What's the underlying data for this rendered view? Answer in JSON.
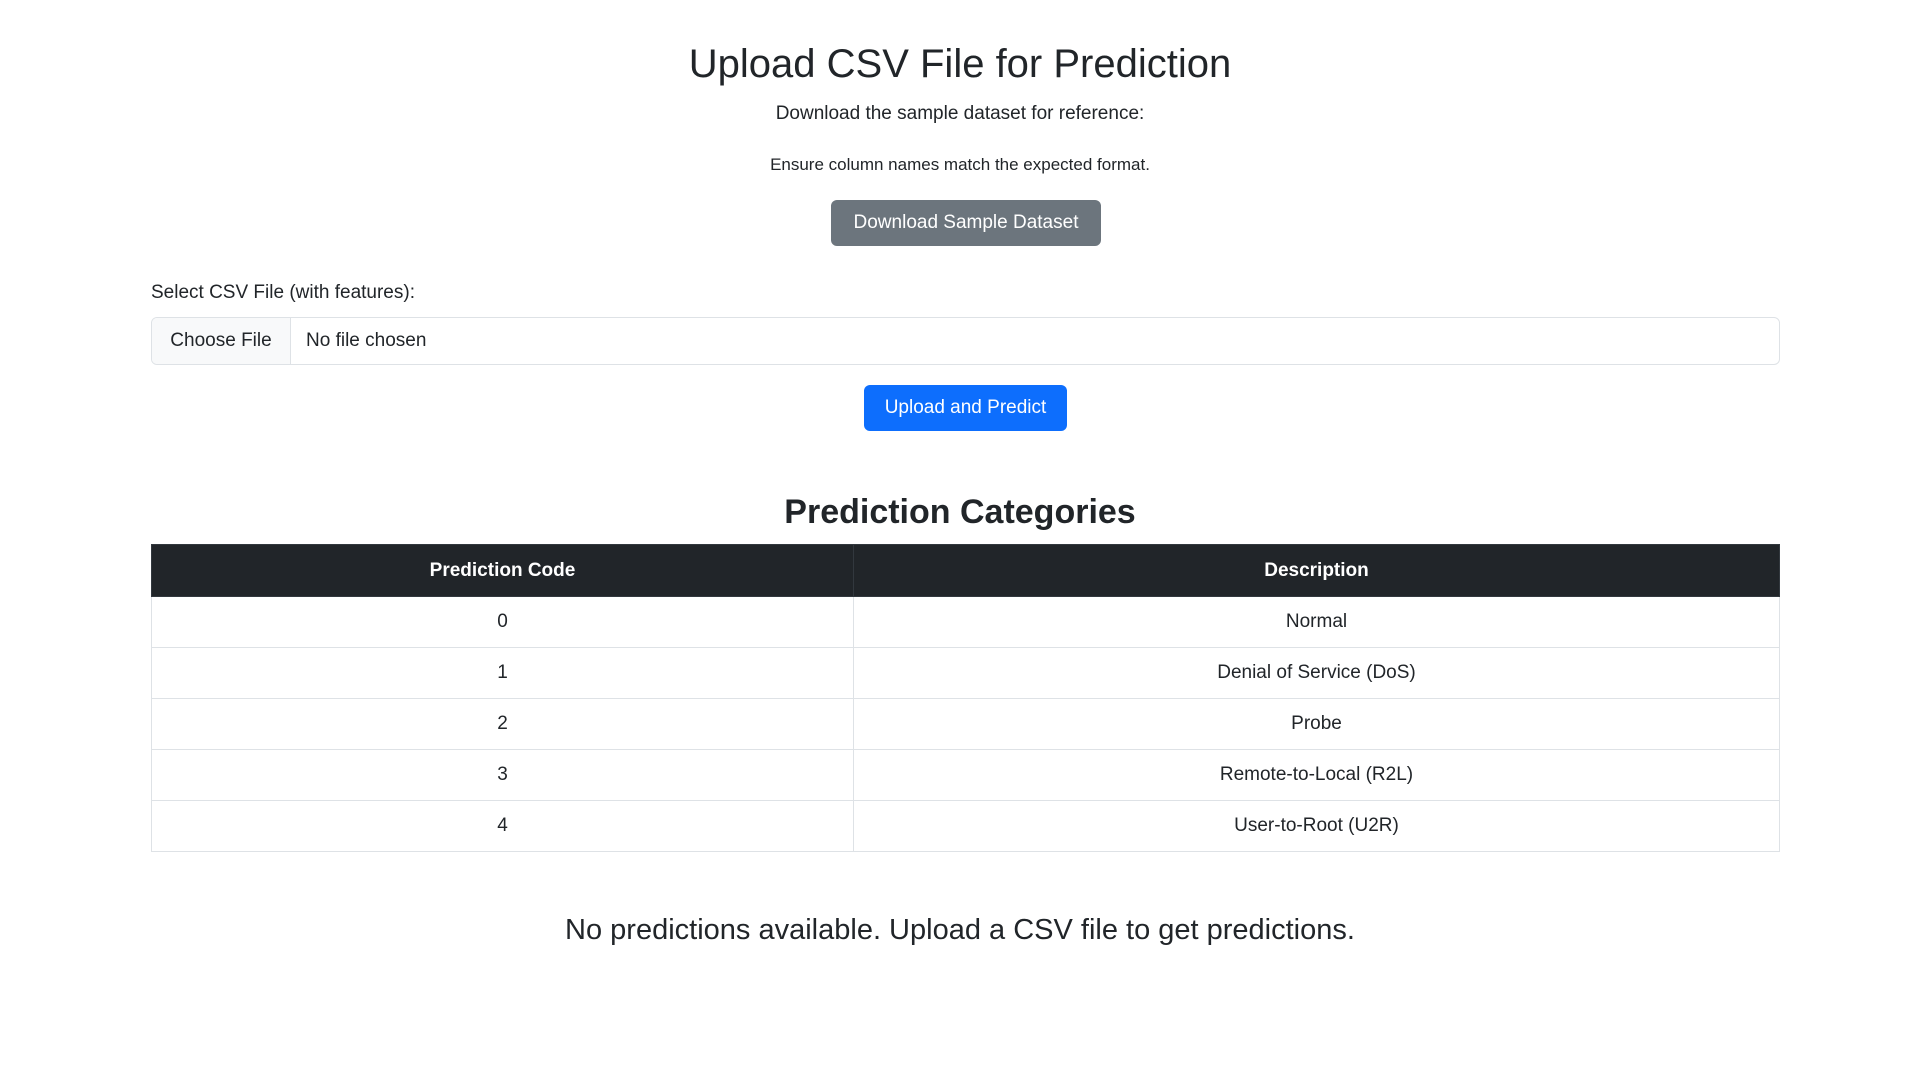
{
  "header": {
    "title": "Upload CSV File for Prediction",
    "subtitle": "Download the sample dataset for reference:",
    "note": "Ensure column names match the expected format.",
    "download_button": "Download Sample Dataset"
  },
  "upload_form": {
    "label": "Select CSV File (with features):",
    "choose_file_button": "Choose File",
    "file_status": "No file chosen",
    "submit_button": "Upload and Predict"
  },
  "categories": {
    "title": "Prediction Categories",
    "columns": [
      "Prediction Code",
      "Description"
    ],
    "rows": [
      [
        "0",
        "Normal"
      ],
      [
        "1",
        "Denial of Service (DoS)"
      ],
      [
        "2",
        "Probe"
      ],
      [
        "3",
        "Remote-to-Local (R2L)"
      ],
      [
        "4",
        "User-to-Root (U2R)"
      ]
    ]
  },
  "results": {
    "empty_message": "No predictions available. Upload a CSV file to get predictions."
  },
  "colors": {
    "primary": "#0d6efd",
    "secondary": "#6c757d",
    "table_header": "#212529"
  }
}
